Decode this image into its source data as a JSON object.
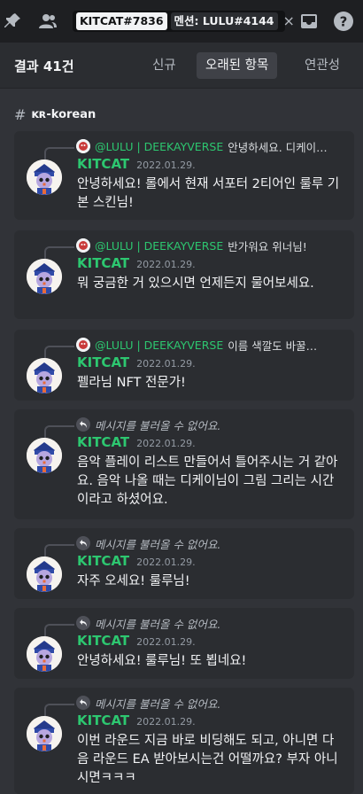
{
  "search": {
    "chip_from": "KITCAT#7836",
    "chip_mentions": "멘션: LULU#4144",
    "clear": "×"
  },
  "toolbar_icons": [
    "pin-icon",
    "members-icon",
    "inbox-icon",
    "help-icon"
  ],
  "header": {
    "result_count": "결과 41건",
    "tabs": [
      "신규",
      "오래된 항목",
      "연관성"
    ],
    "active_tab": "오래된 항목"
  },
  "channel": {
    "hash": "#",
    "name": "ᴋʀ-korean"
  },
  "colors": {
    "username": "#2dc770",
    "background": "#313338",
    "card": "#2b2d31"
  },
  "results": [
    {
      "reply_user": "@LULU | DEEKAYVERSE",
      "reply_text": "안녕하세요. 디케이…",
      "username": "KITCAT",
      "time": "2022.01.29.",
      "body": "안녕하세요! 롤에서 현재 서포터 2티어인 룰루 기본 스킨님!"
    },
    {
      "reply_user": "@LULU | DEEKAYVERSE",
      "reply_text": "반가워요 위너님!",
      "username": "KITCAT",
      "time": "2022.01.29.",
      "body": "뭐 궁금한 거 있으시면 언제든지 물어보세요."
    },
    {
      "reply_user": "@LULU | DEEKAYVERSE",
      "reply_text": "이름 색깔도 바꿀…",
      "username": "KITCAT",
      "time": "2022.01.29.",
      "body": "펠라님 NFT 전문가!"
    },
    {
      "reply_missing": "메시지를 불러올 수 없어요.",
      "username": "KITCAT",
      "time": "2022.01.29.",
      "body": "음악 플레이 리스트 만들어서 틀어주시는 거 같아요. 음악 나올 때는 디케이님이 그림 그리는 시간이라고 하셨어요."
    },
    {
      "reply_missing": "메시지를 불러올 수 없어요.",
      "username": "KITCAT",
      "time": "2022.01.29.",
      "body": "자주 오세요! 룰루님!"
    },
    {
      "reply_missing": "메시지를 불러올 수 없어요.",
      "username": "KITCAT",
      "time": "2022.01.29.",
      "body": "안녕하세요! 룰루님! 또 뵙네요!"
    },
    {
      "reply_missing": "메시지를 불러올 수 없어요.",
      "username": "KITCAT",
      "time": "2022.01.29.",
      "body": "이번 라운드 지금 바로 비딩해도 되고, 아니면 다음 라운드 EA 받아보시는건 어떨까요? 부자 아니시면ㅋㅋㅋ"
    }
  ]
}
